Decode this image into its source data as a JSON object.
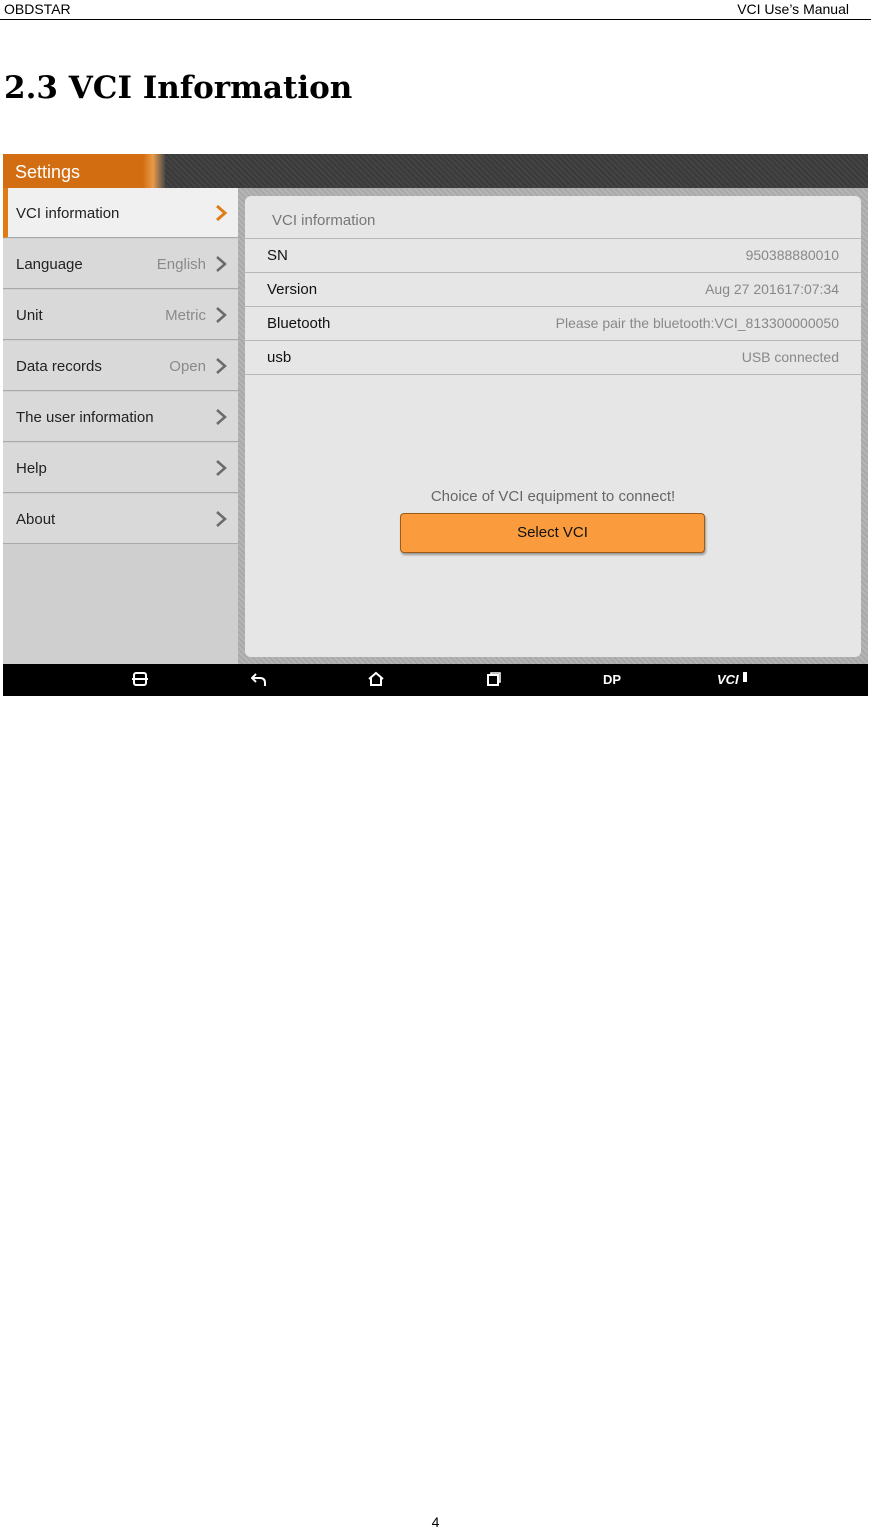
{
  "header": {
    "left": "OBDSTAR",
    "right": "VCI Use’s Manual"
  },
  "section_title": "2.3 VCI Information",
  "app": {
    "tab_title": "Settings",
    "accent_color": "#e07b19",
    "sidebar": [
      {
        "label": "VCI information",
        "value": "",
        "active": true
      },
      {
        "label": "Language",
        "value": "English"
      },
      {
        "label": "Unit",
        "value": "Metric"
      },
      {
        "label": "Data records",
        "value": "Open"
      },
      {
        "label": "The user information",
        "value": ""
      },
      {
        "label": "Help",
        "value": ""
      },
      {
        "label": "About",
        "value": ""
      }
    ],
    "panel": {
      "title": "VCI information",
      "rows": [
        {
          "key": "SN",
          "value": "950388880010"
        },
        {
          "key": "Version",
          "value": "Aug 27 201617:07:34"
        },
        {
          "key": "Bluetooth",
          "value": "Please pair the bluetooth:VCI_813300000050"
        },
        {
          "key": "usb",
          "value": "USB connected"
        }
      ],
      "prompt": "Choice of VCI equipment to connect!",
      "button_label": "Select VCI"
    },
    "navbar": {
      "icons": [
        "screenshot-icon",
        "back-icon",
        "home-icon",
        "recent-apps-icon"
      ],
      "dp_label": "DP",
      "vci_label": "VCI"
    }
  },
  "page_number": "4"
}
